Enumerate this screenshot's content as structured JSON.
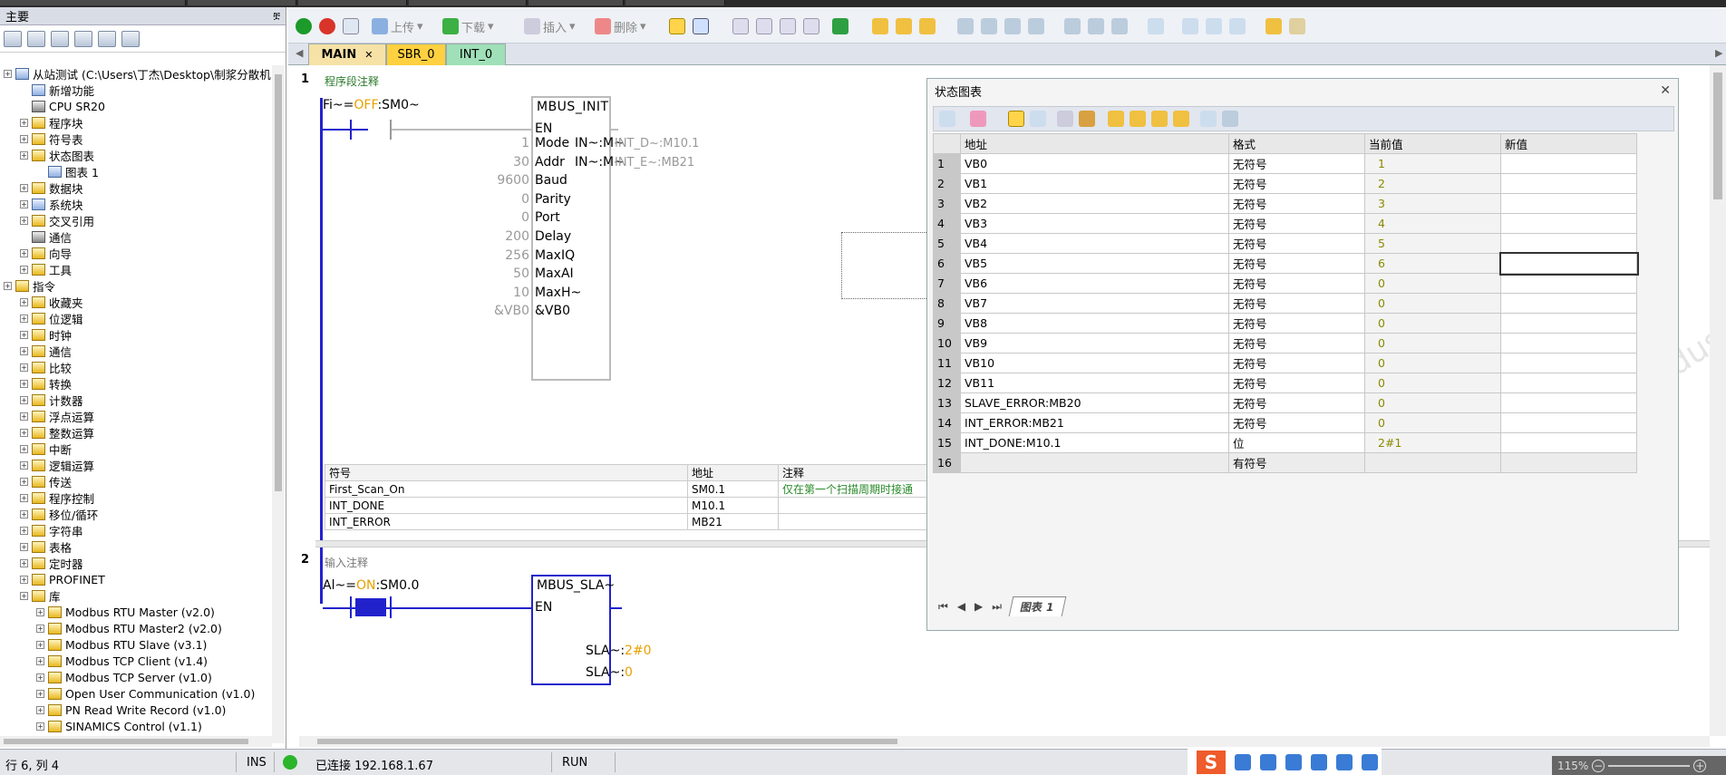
{
  "left_panel": {
    "title": "主要",
    "pin": "ቿ",
    "tree": [
      {
        "label": "从站测试 (C:\\Users\\丁杰\\Desktop\\制浆分散机",
        "level": 0,
        "icon": "project-icon"
      },
      {
        "label": "新增功能",
        "level": 1,
        "icon": "whats-new-icon"
      },
      {
        "label": "CPU SR20",
        "level": 1,
        "icon": "cpu-icon"
      },
      {
        "label": "程序块",
        "level": 1,
        "icon": "folder-icon"
      },
      {
        "label": "符号表",
        "level": 1,
        "icon": "folder-icon"
      },
      {
        "label": "状态图表",
        "level": 1,
        "icon": "folder-icon"
      },
      {
        "label": "图表 1",
        "level": 2,
        "icon": "chart-table-icon"
      },
      {
        "label": "数据块",
        "level": 1,
        "icon": "folder-icon"
      },
      {
        "label": "系统块",
        "level": 1,
        "icon": "system-block-icon"
      },
      {
        "label": "交叉引用",
        "level": 1,
        "icon": "folder-icon"
      },
      {
        "label": "通信",
        "level": 1,
        "icon": "communication-icon"
      },
      {
        "label": "向导",
        "level": 1,
        "icon": "wizard-icon"
      },
      {
        "label": "工具",
        "level": 1,
        "icon": "folder-icon"
      },
      {
        "label": "指令",
        "level": 0,
        "icon": "folder-icon"
      },
      {
        "label": "收藏夹",
        "level": 1,
        "icon": "folder-icon"
      },
      {
        "label": "位逻辑",
        "level": 1,
        "icon": "folder-icon"
      },
      {
        "label": "时钟",
        "level": 1,
        "icon": "folder-icon"
      },
      {
        "label": "通信",
        "level": 1,
        "icon": "folder-icon"
      },
      {
        "label": "比较",
        "level": 1,
        "icon": "folder-icon"
      },
      {
        "label": "转换",
        "level": 1,
        "icon": "folder-icon"
      },
      {
        "label": "计数器",
        "level": 1,
        "icon": "folder-icon"
      },
      {
        "label": "浮点运算",
        "level": 1,
        "icon": "folder-icon"
      },
      {
        "label": "整数运算",
        "level": 1,
        "icon": "folder-icon"
      },
      {
        "label": "中断",
        "level": 1,
        "icon": "folder-icon"
      },
      {
        "label": "逻辑运算",
        "level": 1,
        "icon": "folder-icon"
      },
      {
        "label": "传送",
        "level": 1,
        "icon": "folder-icon"
      },
      {
        "label": "程序控制",
        "level": 1,
        "icon": "folder-icon"
      },
      {
        "label": "移位/循环",
        "level": 1,
        "icon": "folder-icon"
      },
      {
        "label": "字符串",
        "level": 1,
        "icon": "folder-icon"
      },
      {
        "label": "表格",
        "level": 1,
        "icon": "folder-icon"
      },
      {
        "label": "定时器",
        "level": 1,
        "icon": "folder-icon"
      },
      {
        "label": "PROFINET",
        "level": 1,
        "icon": "folder-icon"
      },
      {
        "label": "库",
        "level": 1,
        "icon": "folder-icon"
      },
      {
        "label": "Modbus RTU Master (v2.0)",
        "level": 2,
        "icon": "library-icon"
      },
      {
        "label": "Modbus RTU Master2 (v2.0)",
        "level": 2,
        "icon": "library-icon"
      },
      {
        "label": "Modbus RTU Slave (v3.1)",
        "level": 2,
        "icon": "library-icon"
      },
      {
        "label": "Modbus TCP Client (v1.4)",
        "level": 2,
        "icon": "library-icon"
      },
      {
        "label": "Modbus TCP Server (v1.0)",
        "level": 2,
        "icon": "library-icon"
      },
      {
        "label": "Open User Communication (v1.0)",
        "level": 2,
        "icon": "library-icon"
      },
      {
        "label": "PN Read Write Record (v1.0)",
        "level": 2,
        "icon": "library-icon"
      },
      {
        "label": "SINAMICS Control (v1.1)",
        "level": 2,
        "icon": "library-icon"
      }
    ]
  },
  "toolbar": {
    "upload": "上传",
    "download": "下载",
    "insert": "插入",
    "delete": "删除"
  },
  "tabs": [
    {
      "label": "MAIN",
      "close": "✕",
      "color": "#f6e2a6",
      "active": true
    },
    {
      "label": "SBR_0",
      "color": "#ffd040",
      "active": false
    },
    {
      "label": "INT_0",
      "color": "#9fe0b8",
      "active": false
    }
  ],
  "networks": {
    "n1": {
      "number": "1",
      "comment": "程序段注释",
      "contact": {
        "name": "Fi~",
        "eq": "=",
        "state": "OFF",
        "addr": ":SM0~"
      },
      "block": {
        "title": "MBUS_INIT",
        "en": "EN",
        "pins": [
          {
            "value": "1",
            "name": "Mode",
            "out_name": "IN~:M~",
            "out_value": "INT_D~:M10.1"
          },
          {
            "value": "30",
            "name": "Addr",
            "out_name": "IN~:M~",
            "out_value": "INT_E~:MB21"
          },
          {
            "value": "9600",
            "name": "Baud"
          },
          {
            "value": "0",
            "name": "Parity"
          },
          {
            "value": "0",
            "name": "Port"
          },
          {
            "value": "200",
            "name": "Delay"
          },
          {
            "value": "256",
            "name": "MaxIQ"
          },
          {
            "value": "50",
            "name": "MaxAI"
          },
          {
            "value": "10",
            "name": "MaxH~"
          },
          {
            "value": "&VB0",
            "name": "&VB0"
          }
        ]
      },
      "symbol_table": {
        "headers": [
          "符号",
          "地址",
          "注释"
        ],
        "rows": [
          [
            "First_Scan_On",
            "SM0.1",
            "仅在第一个扫描周期时接通"
          ],
          [
            "INT_DONE",
            "M10.1",
            ""
          ],
          [
            "INT_ERROR",
            "MB21",
            ""
          ]
        ]
      }
    },
    "n2": {
      "number": "2",
      "comment": "输入注释",
      "contact": {
        "name": "Al~",
        "eq": "=",
        "state": "ON",
        "addr": ":SM0.0"
      },
      "block": {
        "title": "MBUS_SLA~",
        "en": "EN",
        "outs": [
          {
            "name": "SLA~:",
            "value": "2#0"
          },
          {
            "name": "SLA~:",
            "value": "0"
          }
        ]
      }
    }
  },
  "status_chart": {
    "title": "状态图表",
    "close": "✕",
    "headers": [
      "地址",
      "格式",
      "当前值",
      "新值"
    ],
    "rows": [
      {
        "n": "1",
        "addr": "VB0",
        "fmt": "无符号",
        "cur": "1",
        "new": ""
      },
      {
        "n": "2",
        "addr": "VB1",
        "fmt": "无符号",
        "cur": "2",
        "new": ""
      },
      {
        "n": "3",
        "addr": "VB2",
        "fmt": "无符号",
        "cur": "3",
        "new": ""
      },
      {
        "n": "4",
        "addr": "VB3",
        "fmt": "无符号",
        "cur": "4",
        "new": ""
      },
      {
        "n": "5",
        "addr": "VB4",
        "fmt": "无符号",
        "cur": "5",
        "new": ""
      },
      {
        "n": "6",
        "addr": "VB5",
        "fmt": "无符号",
        "cur": "6",
        "new": ""
      },
      {
        "n": "7",
        "addr": "VB6",
        "fmt": "无符号",
        "cur": "0",
        "new": ""
      },
      {
        "n": "8",
        "addr": "VB7",
        "fmt": "无符号",
        "cur": "0",
        "new": ""
      },
      {
        "n": "9",
        "addr": "VB8",
        "fmt": "无符号",
        "cur": "0",
        "new": ""
      },
      {
        "n": "10",
        "addr": "VB9",
        "fmt": "无符号",
        "cur": "0",
        "new": ""
      },
      {
        "n": "11",
        "addr": "VB10",
        "fmt": "无符号",
        "cur": "0",
        "new": ""
      },
      {
        "n": "12",
        "addr": "VB11",
        "fmt": "无符号",
        "cur": "0",
        "new": ""
      },
      {
        "n": "13",
        "addr": "SLAVE_ERROR:MB20",
        "fmt": "无符号",
        "cur": "0",
        "new": ""
      },
      {
        "n": "14",
        "addr": "INT_ERROR:MB21",
        "fmt": "无符号",
        "cur": "0",
        "new": ""
      },
      {
        "n": "15",
        "addr": "INT_DONE:M10.1",
        "fmt": "位",
        "cur": "2#1",
        "new": ""
      },
      {
        "n": "16",
        "addr": "",
        "fmt": "有符号",
        "cur": "",
        "new": ""
      }
    ],
    "sheet_tab": "图表 1"
  },
  "status_bar": {
    "position": "行 6, 列 4",
    "mode": "INS",
    "connection": "已连接 192.168.1.67",
    "run_state": "RUN",
    "zoom": "115%"
  },
  "watermark": "西门子工业  找答案  support.industry.siemens.com"
}
